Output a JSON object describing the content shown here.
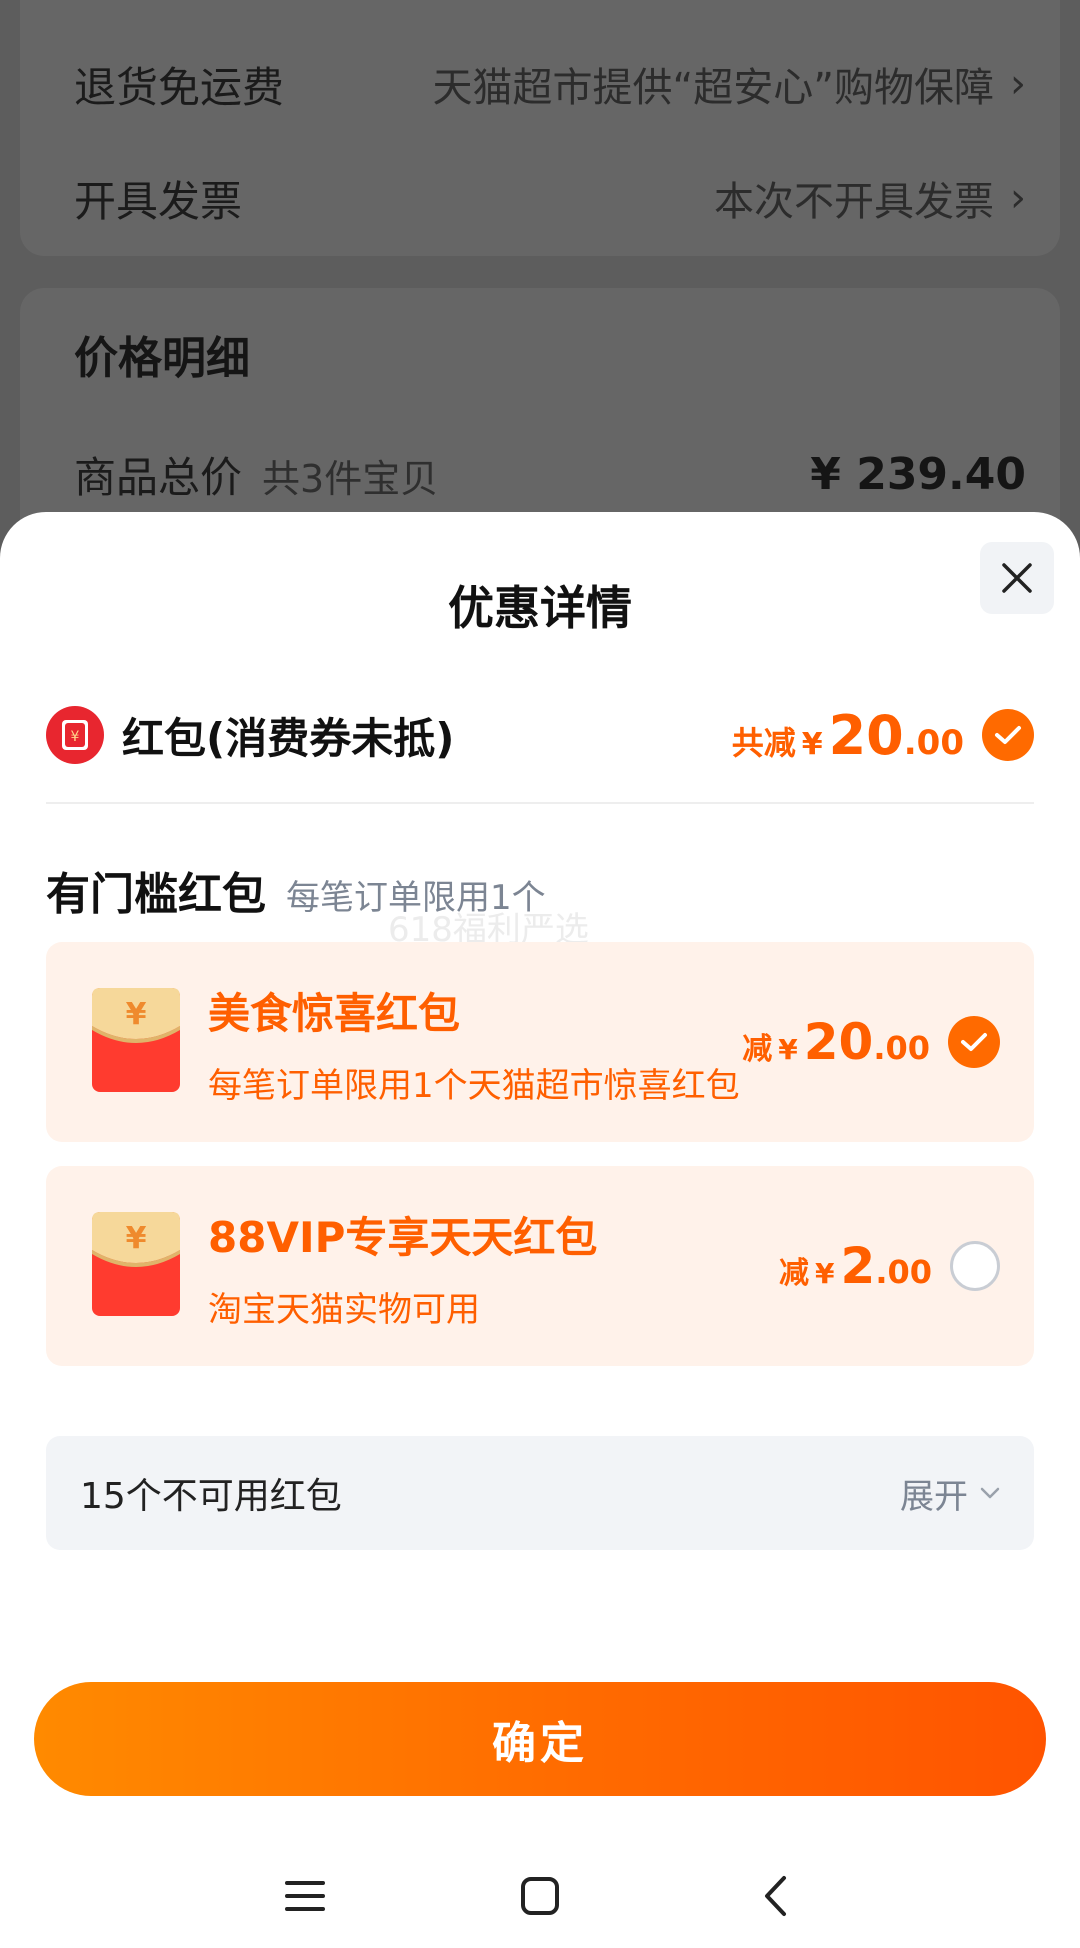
{
  "background": {
    "rows": [
      {
        "label": "退货免运费",
        "value": "天猫超市提供“超安心”购物保障"
      },
      {
        "label": "开具发票",
        "value": "本次不开具发票"
      }
    ],
    "price_section": {
      "title": "价格明细",
      "total_label": "商品总价",
      "total_note": "共3件宝贝",
      "total_value": "¥ 239.40"
    }
  },
  "sheet": {
    "title": "优惠详情",
    "hongbao": {
      "label": "红包(消费券未抵)",
      "prefix": "共减",
      "currency": "¥",
      "amount_int": "20",
      "amount_dec": ".00",
      "checked": true
    },
    "section": {
      "title": "有门槛红包",
      "note": "每笔订单限用1个",
      "watermark": "618福利严选"
    },
    "coupons": [
      {
        "title": "美食惊喜红包",
        "desc": "每笔订单限用1个天猫超市惊喜红包",
        "prefix": "减",
        "currency": "¥",
        "amount_int": "20",
        "amount_dec": ".00",
        "checked": true
      },
      {
        "title": "88VIP专享天天红包",
        "desc": "淘宝天猫实物可用",
        "prefix": "减",
        "currency": "¥",
        "amount_int": "2",
        "amount_dec": ".00",
        "checked": false
      }
    ],
    "unavailable": {
      "label": "15个不可用红包",
      "expand": "展开"
    },
    "confirm": "确定"
  },
  "colors": {
    "accent": "#ff6a00",
    "coupon_bg": "#fff2ea",
    "hongbao_red": "#e8262f"
  },
  "icons": [
    "chevron-right-icon",
    "close-icon",
    "red-envelope-icon",
    "check-icon",
    "chevron-down-icon",
    "menu-icon",
    "home-icon",
    "back-icon"
  ]
}
